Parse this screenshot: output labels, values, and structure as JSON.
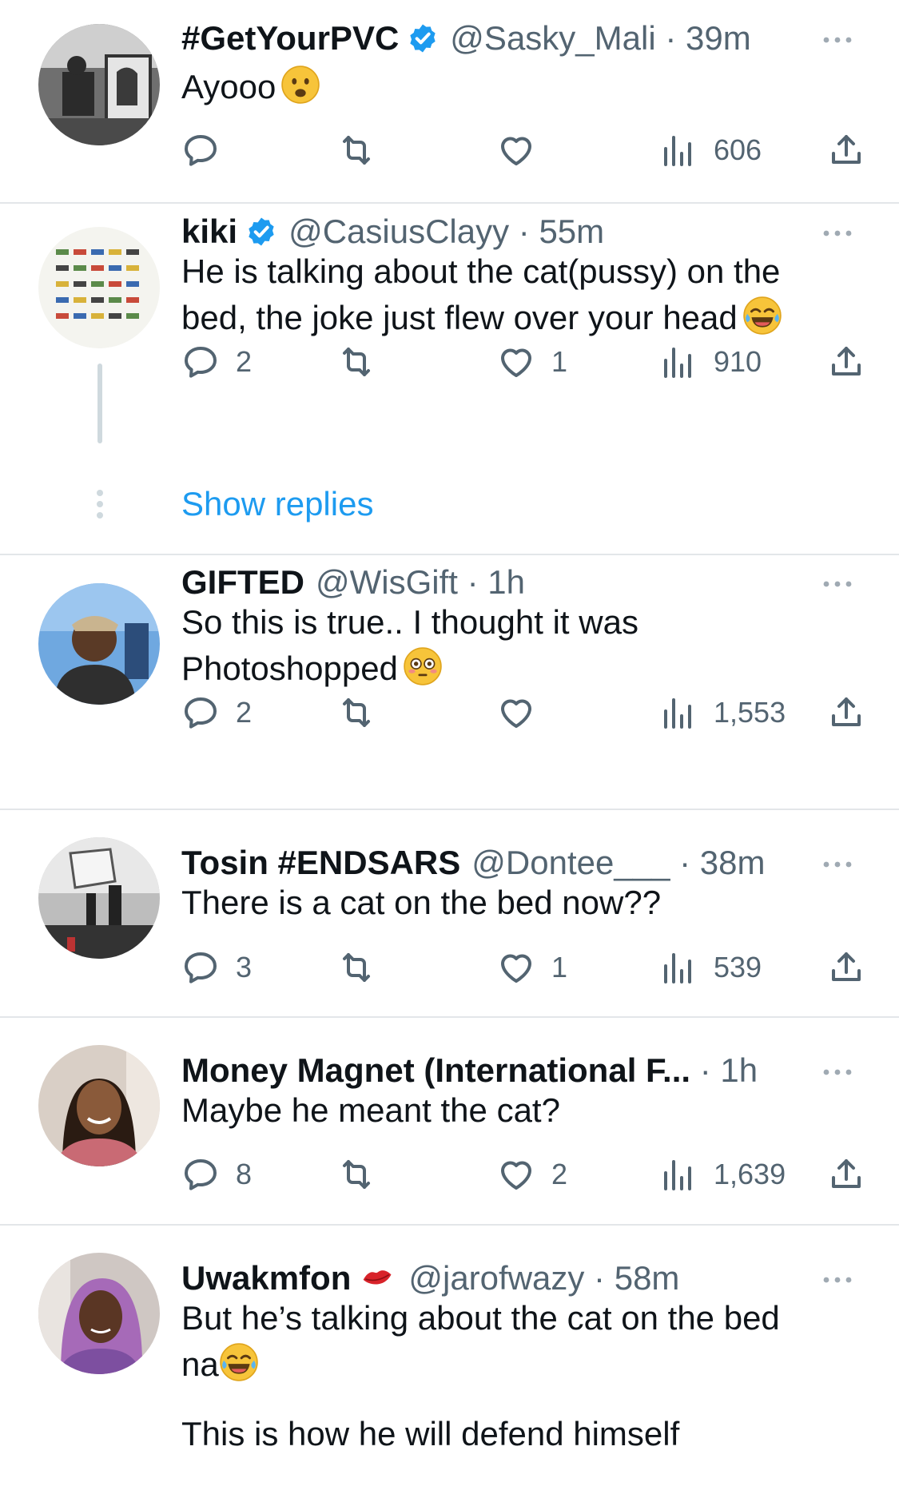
{
  "colors": {
    "accent": "#1d9bf0",
    "secondary_text": "#536471",
    "divider": "#e3e6e9",
    "verified": "#1d9bf0"
  },
  "icons": {
    "reply": "reply-icon",
    "retweet": "retweet-icon",
    "like": "heart-icon",
    "views": "views-icon",
    "share": "share-icon",
    "more": "more-icon",
    "verified": "verified-badge-icon"
  },
  "tweets": [
    {
      "name": "#GetYourPVC",
      "verified": true,
      "handle": "@Sasky_Mali",
      "dot": " · ",
      "time": "39m",
      "text": "Ayooo",
      "emoji": "frowning-face-emoji",
      "replies": "",
      "retweets": "",
      "likes": "",
      "views": "606"
    },
    {
      "name": "kiki",
      "verified": true,
      "handle": "@CasiusClayy",
      "dot": " · ",
      "time": "55m",
      "text": "He is talking about the cat(pussy) on the\nbed, the joke just flew over your head",
      "emoji": "tears-of-joy-emoji",
      "replies": "2",
      "retweets": "",
      "likes": "1",
      "views": "910",
      "show_replies": "Show replies"
    },
    {
      "name": "GIFTED",
      "verified": false,
      "handle": "@WisGift",
      "dot": " · ",
      "time": "1h",
      "text": "So this is true.. I thought it was\nPhotoshopped",
      "emoji": "flushed-face-emoji",
      "replies": "2",
      "retweets": "",
      "likes": "",
      "views": "1,553"
    },
    {
      "name": "Tosin #ENDSARS",
      "verified": false,
      "handle": "@Dontee___",
      "dot": " · ",
      "time": "38m",
      "text": "There is a cat on the bed now??",
      "replies": "3",
      "retweets": "",
      "likes": "1",
      "views": "539"
    },
    {
      "name": "Money Magnet (International F...",
      "verified": false,
      "handle": "",
      "dot": " · ",
      "time": "1h",
      "text": "Maybe he meant the cat?",
      "replies": "8",
      "retweets": "",
      "likes": "2",
      "views": "1,639"
    },
    {
      "name": "Uwakmfon",
      "verified": false,
      "name_emoji": "kiss-mark-emoji",
      "handle": "@jarofwazy",
      "dot": " · ",
      "time": "58m",
      "text": "But he’s talking about the cat on the bed\nna",
      "emoji": "tears-of-joy-emoji",
      "text2": "This is how he will defend himself"
    }
  ]
}
